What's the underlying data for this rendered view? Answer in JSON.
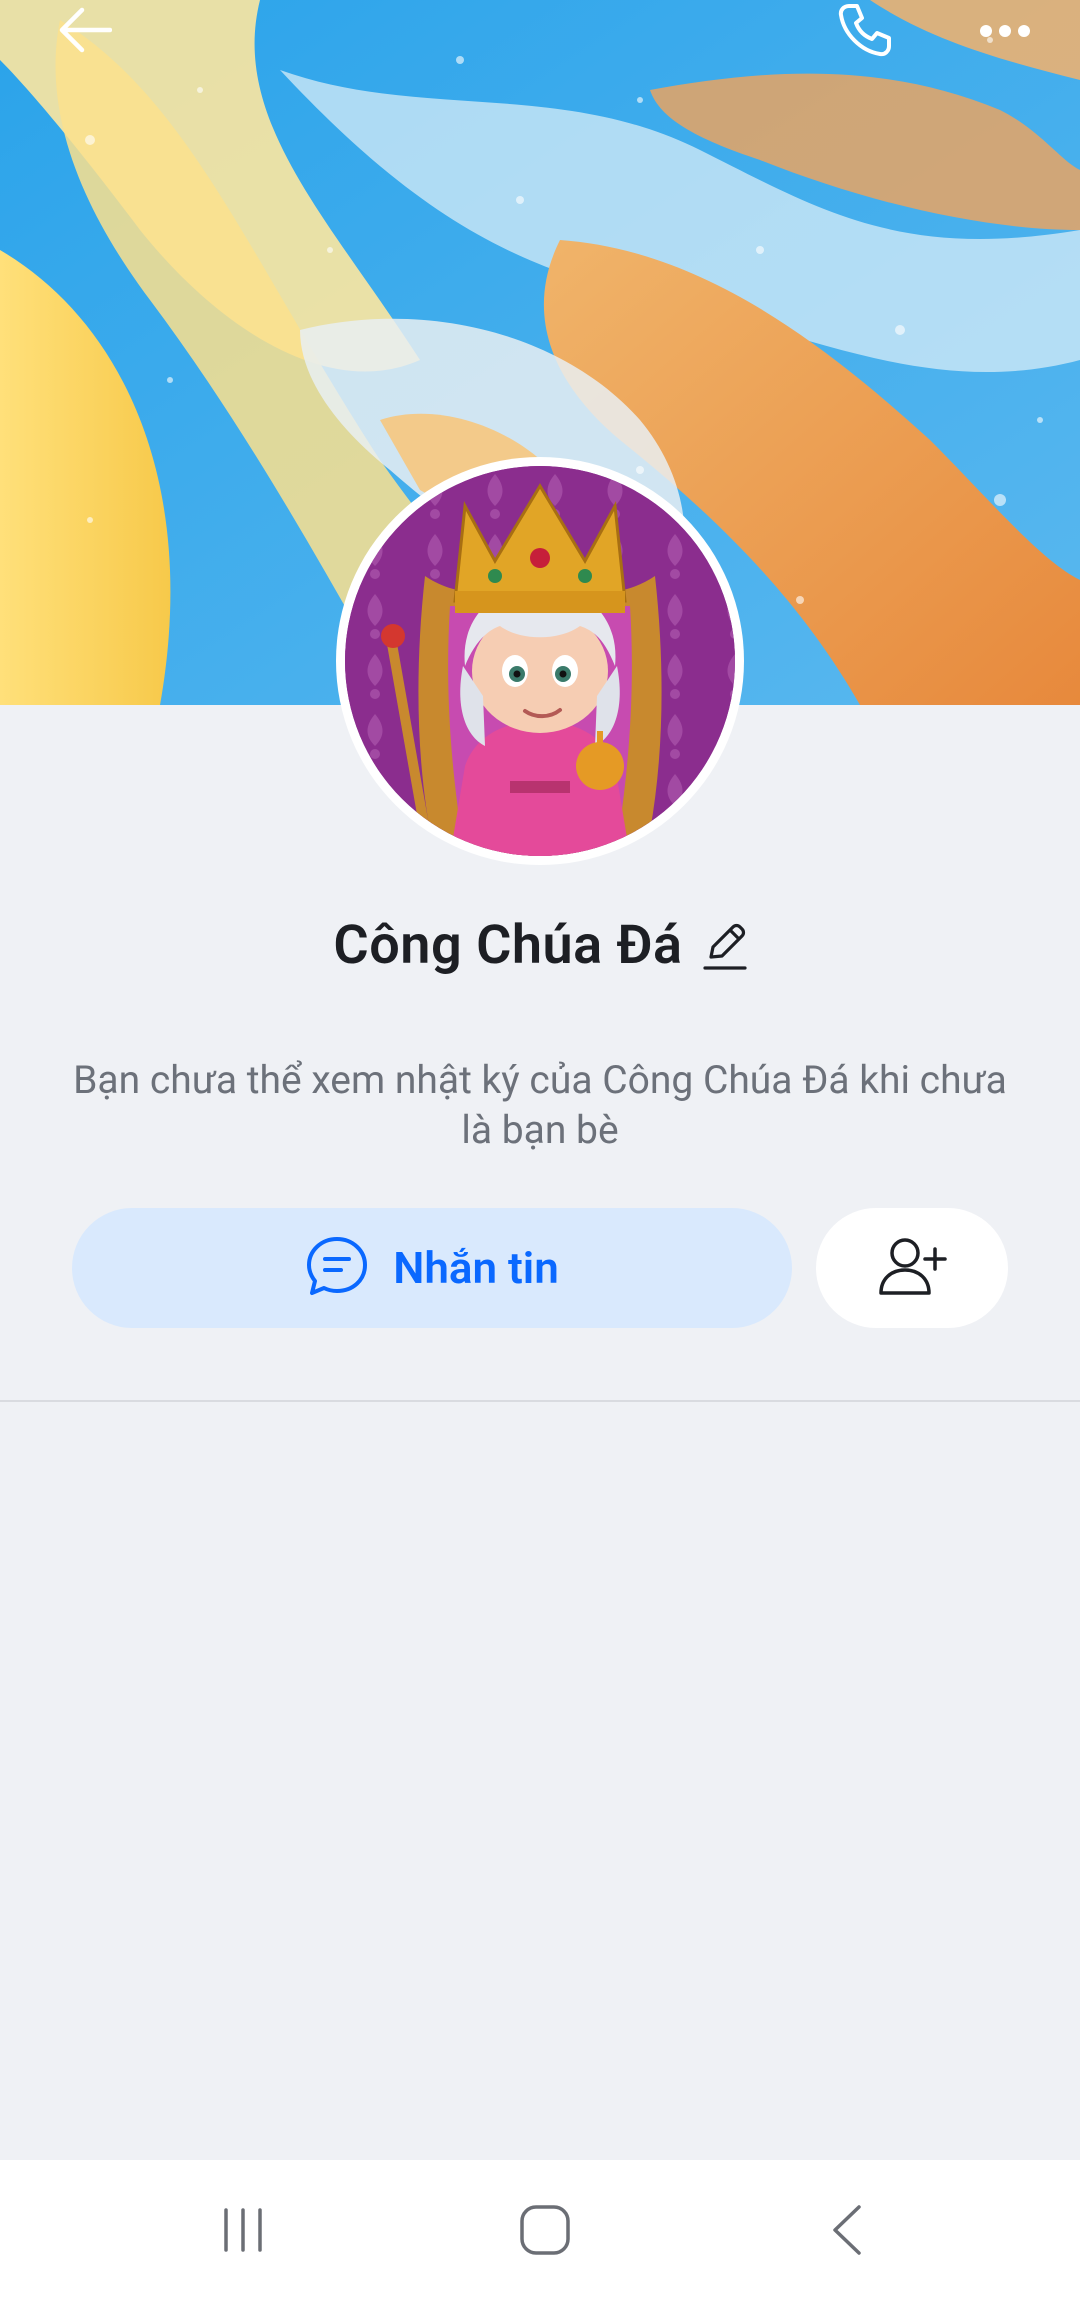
{
  "profile": {
    "name": "Công Chúa Đá",
    "privacy_note": "Bạn chưa thể xem nhật ký của Công Chúa Đá khi chưa là bạn bè"
  },
  "actions": {
    "message_label": "Nhắn tin"
  },
  "icons": {
    "back": "arrow-left-icon",
    "call": "phone-icon",
    "more": "more-dots-icon",
    "edit": "pencil-icon",
    "message": "chat-bubble-icon",
    "add_friend": "add-user-icon",
    "nav_recent": "recent-apps-icon",
    "nav_home": "home-icon",
    "nav_back": "chevron-left-icon"
  },
  "colors": {
    "accent": "#0a68ff",
    "message_button_bg": "#d9e9fd",
    "page_bg": "#eff1f5"
  }
}
